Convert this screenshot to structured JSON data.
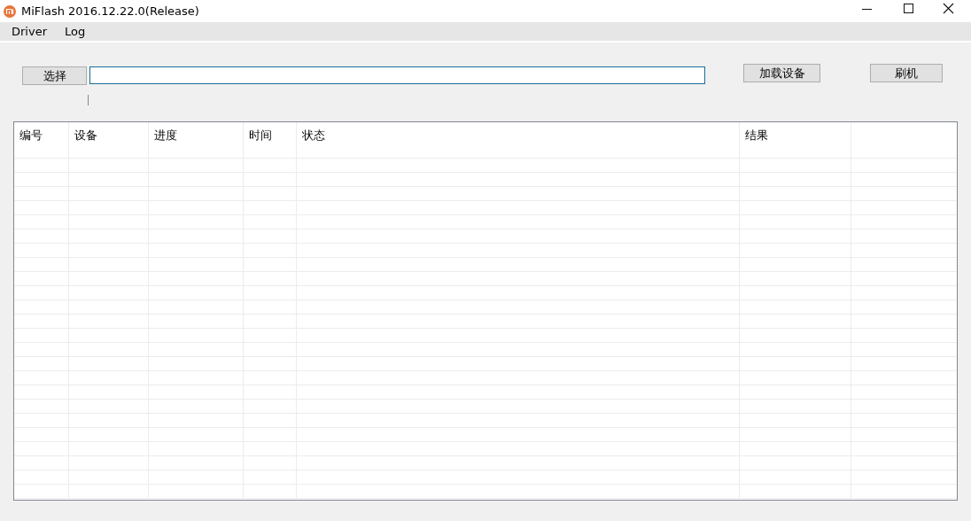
{
  "window": {
    "title": "MiFlash 2016.12.22.0(Release)"
  },
  "menu": [
    {
      "label": "Driver"
    },
    {
      "label": "Log"
    }
  ],
  "toolbar": {
    "select_button": "选择",
    "load_devices_button": "加载设备",
    "flash_button": "刷机"
  },
  "table": {
    "columns": [
      {
        "label": "编号"
      },
      {
        "label": "设备"
      },
      {
        "label": "进度"
      },
      {
        "label": "时间"
      },
      {
        "label": "状态"
      },
      {
        "label": "结果"
      }
    ]
  }
}
